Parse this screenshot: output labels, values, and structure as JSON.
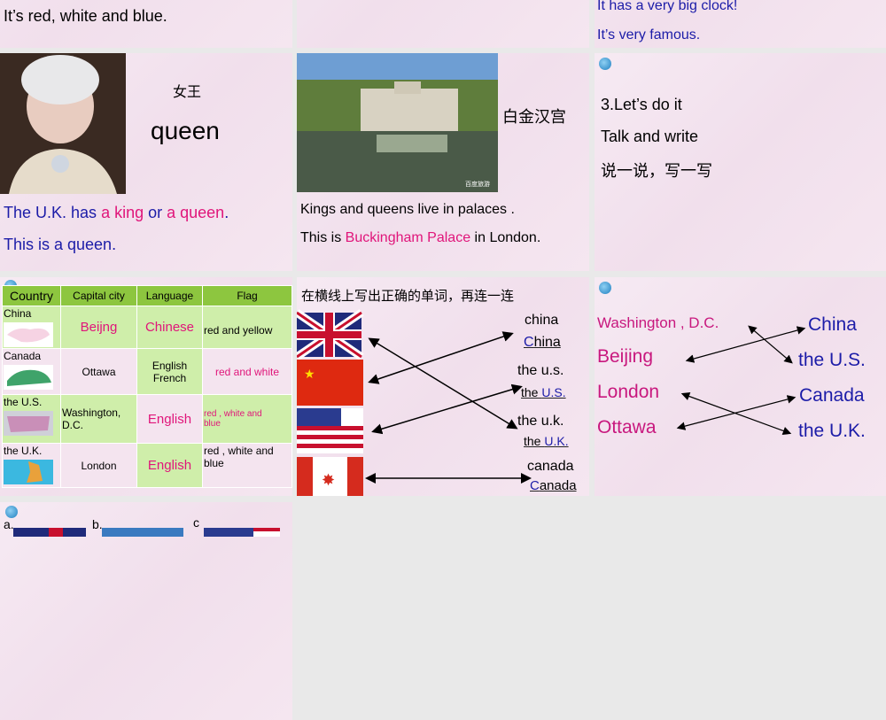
{
  "slides": {
    "s1": {
      "text": "It’s red, white and blue."
    },
    "s2": {},
    "s3": {
      "line1": "It has a very big clock!",
      "line2": "It’s very famous."
    },
    "s4": {
      "cn_label": "女王",
      "word": "queen",
      "sentence": {
        "p1": "The U.K. has ",
        "p2": "a king",
        "p3": " or ",
        "p4": "a queen",
        "p5": "."
      },
      "line2": "This is a queen."
    },
    "s5": {
      "cn_label": "白金汉宫",
      "line1": "Kings and queens live in palaces .",
      "line2_a": "This is ",
      "line2_b": "Buckingham Palace",
      "line2_c": " in London.",
      "photo_watermark": "百度旅游"
    },
    "s6": {
      "title": "3.Let’s do it",
      "sub": "Talk and write",
      "cn": "说一说，写一写"
    },
    "s7": {
      "headers": [
        "Country",
        "Capital city",
        "Language",
        "Flag"
      ],
      "rows": [
        {
          "country": "China",
          "capital": "Beijng",
          "language": "Chinese",
          "flag": "red and yellow"
        },
        {
          "country": "Canada",
          "capital": "Ottawa",
          "language": "English",
          "language2": "French",
          "flag": "red and white"
        },
        {
          "country": "the U.S.",
          "capital": "Washington, D.C.",
          "language": "English",
          "flag": "red , white and blue"
        },
        {
          "country": "the U.K.",
          "capital": "London",
          "language": "English",
          "flag": "red , white and blue"
        }
      ]
    },
    "s8": {
      "title": "在横线上写出正确的单词，再连一连",
      "words": [
        {
          "lower": "china",
          "a": "C",
          "b": "hina"
        },
        {
          "lower": "the u.s.",
          "a": "the ",
          "b": "U.S."
        },
        {
          "lower": "the u.k.",
          "a": "the ",
          "b": "U.K."
        },
        {
          "lower": "canada",
          "a": "C",
          "b": "anada"
        }
      ]
    },
    "s9": {
      "cities": [
        "Washington , D.C.",
        "Beijing",
        "London",
        "Ottawa"
      ],
      "countries": [
        "China",
        "the U.S.",
        "Canada",
        "the U.K."
      ]
    },
    "s10": {
      "labels": [
        "a.",
        "b.",
        "c"
      ]
    }
  },
  "colors": {
    "blue": "#1c1ca8",
    "pink": "#e0157a",
    "green": "#8dc63f"
  }
}
